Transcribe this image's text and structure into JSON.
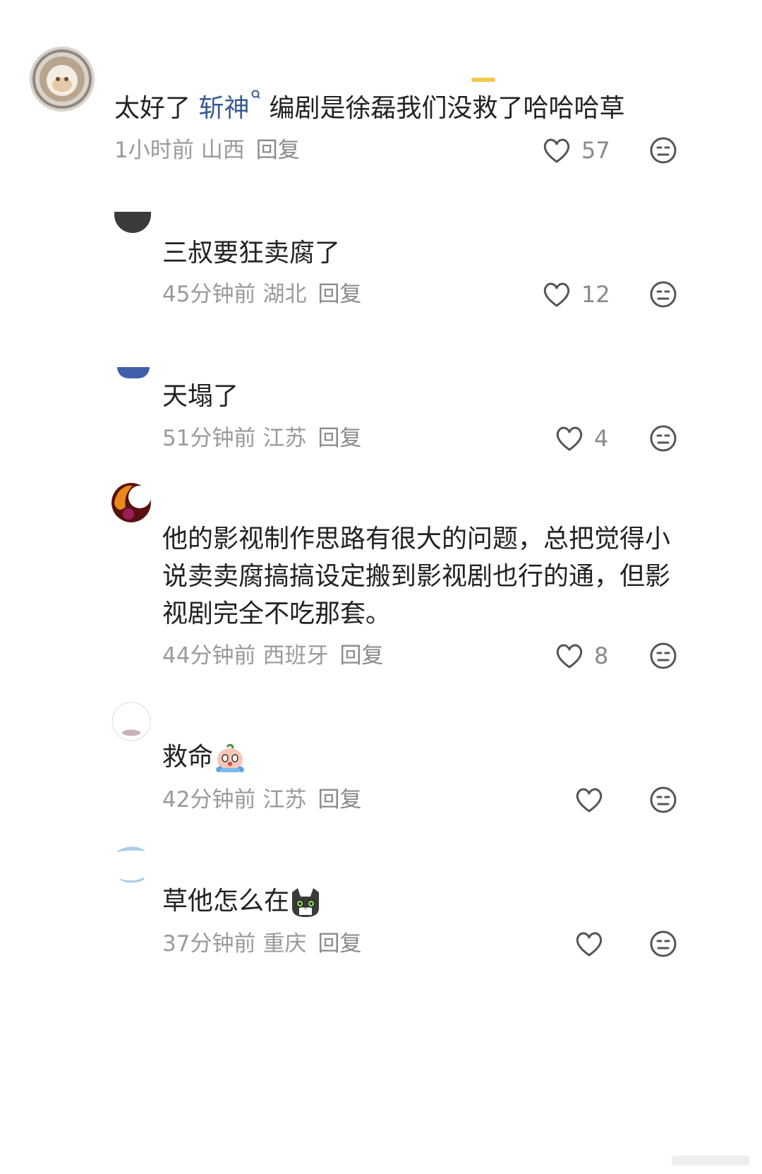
{
  "comments": [
    {
      "text_before": "太好了 ",
      "mention": "斩神",
      "text_after": "编剧是徐磊我们没救了哈哈哈草",
      "time": "1小时前",
      "location": "山西",
      "reply_label": "回复",
      "likes": "57"
    },
    {
      "text": "三叔要狂卖腐了",
      "time": "45分钟前",
      "location": "湖北",
      "reply_label": "回复",
      "likes": "12"
    },
    {
      "text": "天塌了",
      "time": "51分钟前",
      "location": "江苏",
      "reply_label": "回复",
      "likes": "4"
    },
    {
      "text": "他的影视制作思路有很大的问题，总把觉得小说卖卖腐搞搞设定搬到影视剧也行的通，但影视剧完全不吃那套。",
      "time": "44分钟前",
      "location": "西班牙",
      "reply_label": "回复",
      "likes": "8"
    },
    {
      "text": "救命",
      "emoji": "crying-face-emoji",
      "time": "42分钟前",
      "location": "江苏",
      "reply_label": "回复",
      "likes": ""
    },
    {
      "text": "草他怎么在",
      "emoji": "cat-face-emoji",
      "time": "37分钟前",
      "location": "重庆",
      "reply_label": "回复",
      "likes": ""
    }
  ],
  "icons": {
    "like": "heart-outline-icon",
    "dislike": "neutral-face-icon"
  },
  "colors": {
    "text": "#222222",
    "meta": "#9a9a9a",
    "mention": "#3a5b94",
    "accent": "#f2c94c"
  }
}
